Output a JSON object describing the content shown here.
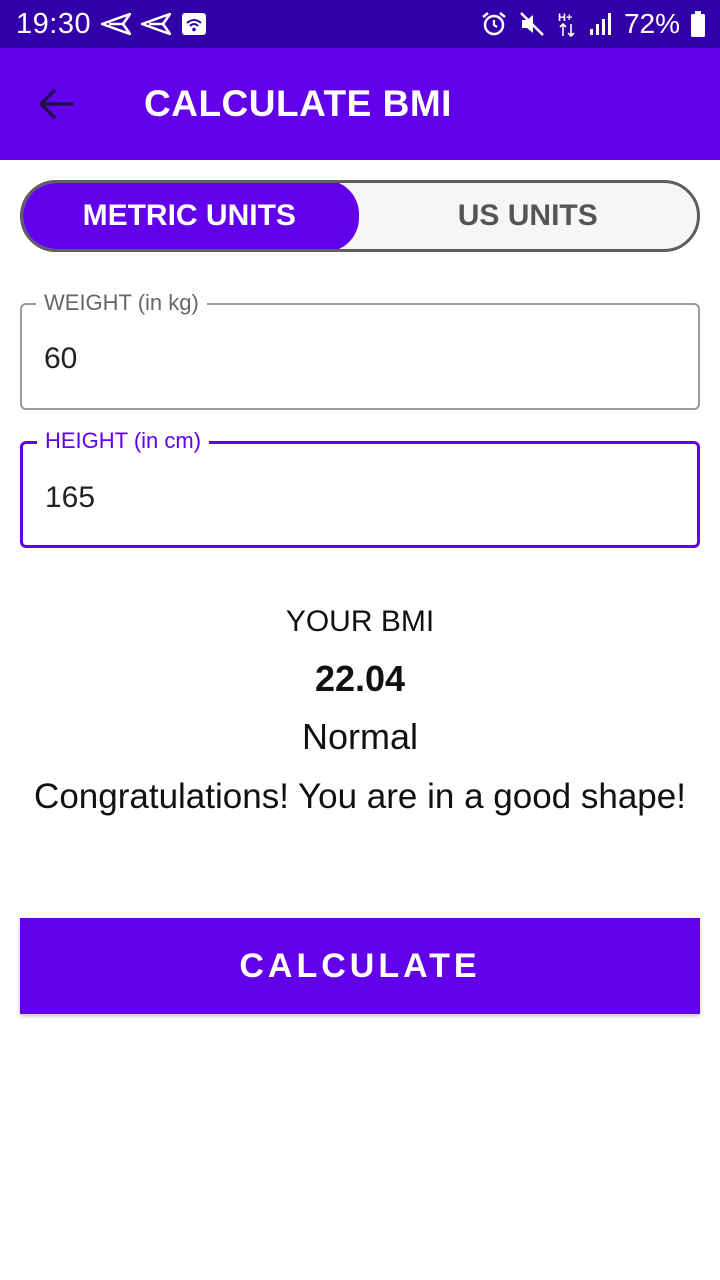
{
  "status_bar": {
    "time": "19:30",
    "battery_percent": "72%",
    "left_icons": [
      "send-icon",
      "send-icon",
      "wifi-box-icon"
    ],
    "right_icons": [
      "alarm-icon",
      "mute-icon",
      "hplus-data-icon",
      "signal-icon",
      "battery-icon"
    ]
  },
  "app_bar": {
    "title": "CALCULATE BMI",
    "back_icon": "arrow-left-icon"
  },
  "units": {
    "metric_label": "METRIC UNITS",
    "us_label": "US UNITS",
    "selected": "metric"
  },
  "form": {
    "weight_label": "WEIGHT (in kg)",
    "weight_value": "60",
    "height_label": "HEIGHT (in cm)",
    "height_value": "165"
  },
  "result": {
    "heading": "YOUR BMI",
    "value": "22.04",
    "category": "Normal",
    "message": "Congratulations! You are in a good shape!"
  },
  "actions": {
    "calculate_label": "CALCULATE"
  },
  "colors": {
    "primary": "#6200ea",
    "status_bar": "#3200a9"
  }
}
